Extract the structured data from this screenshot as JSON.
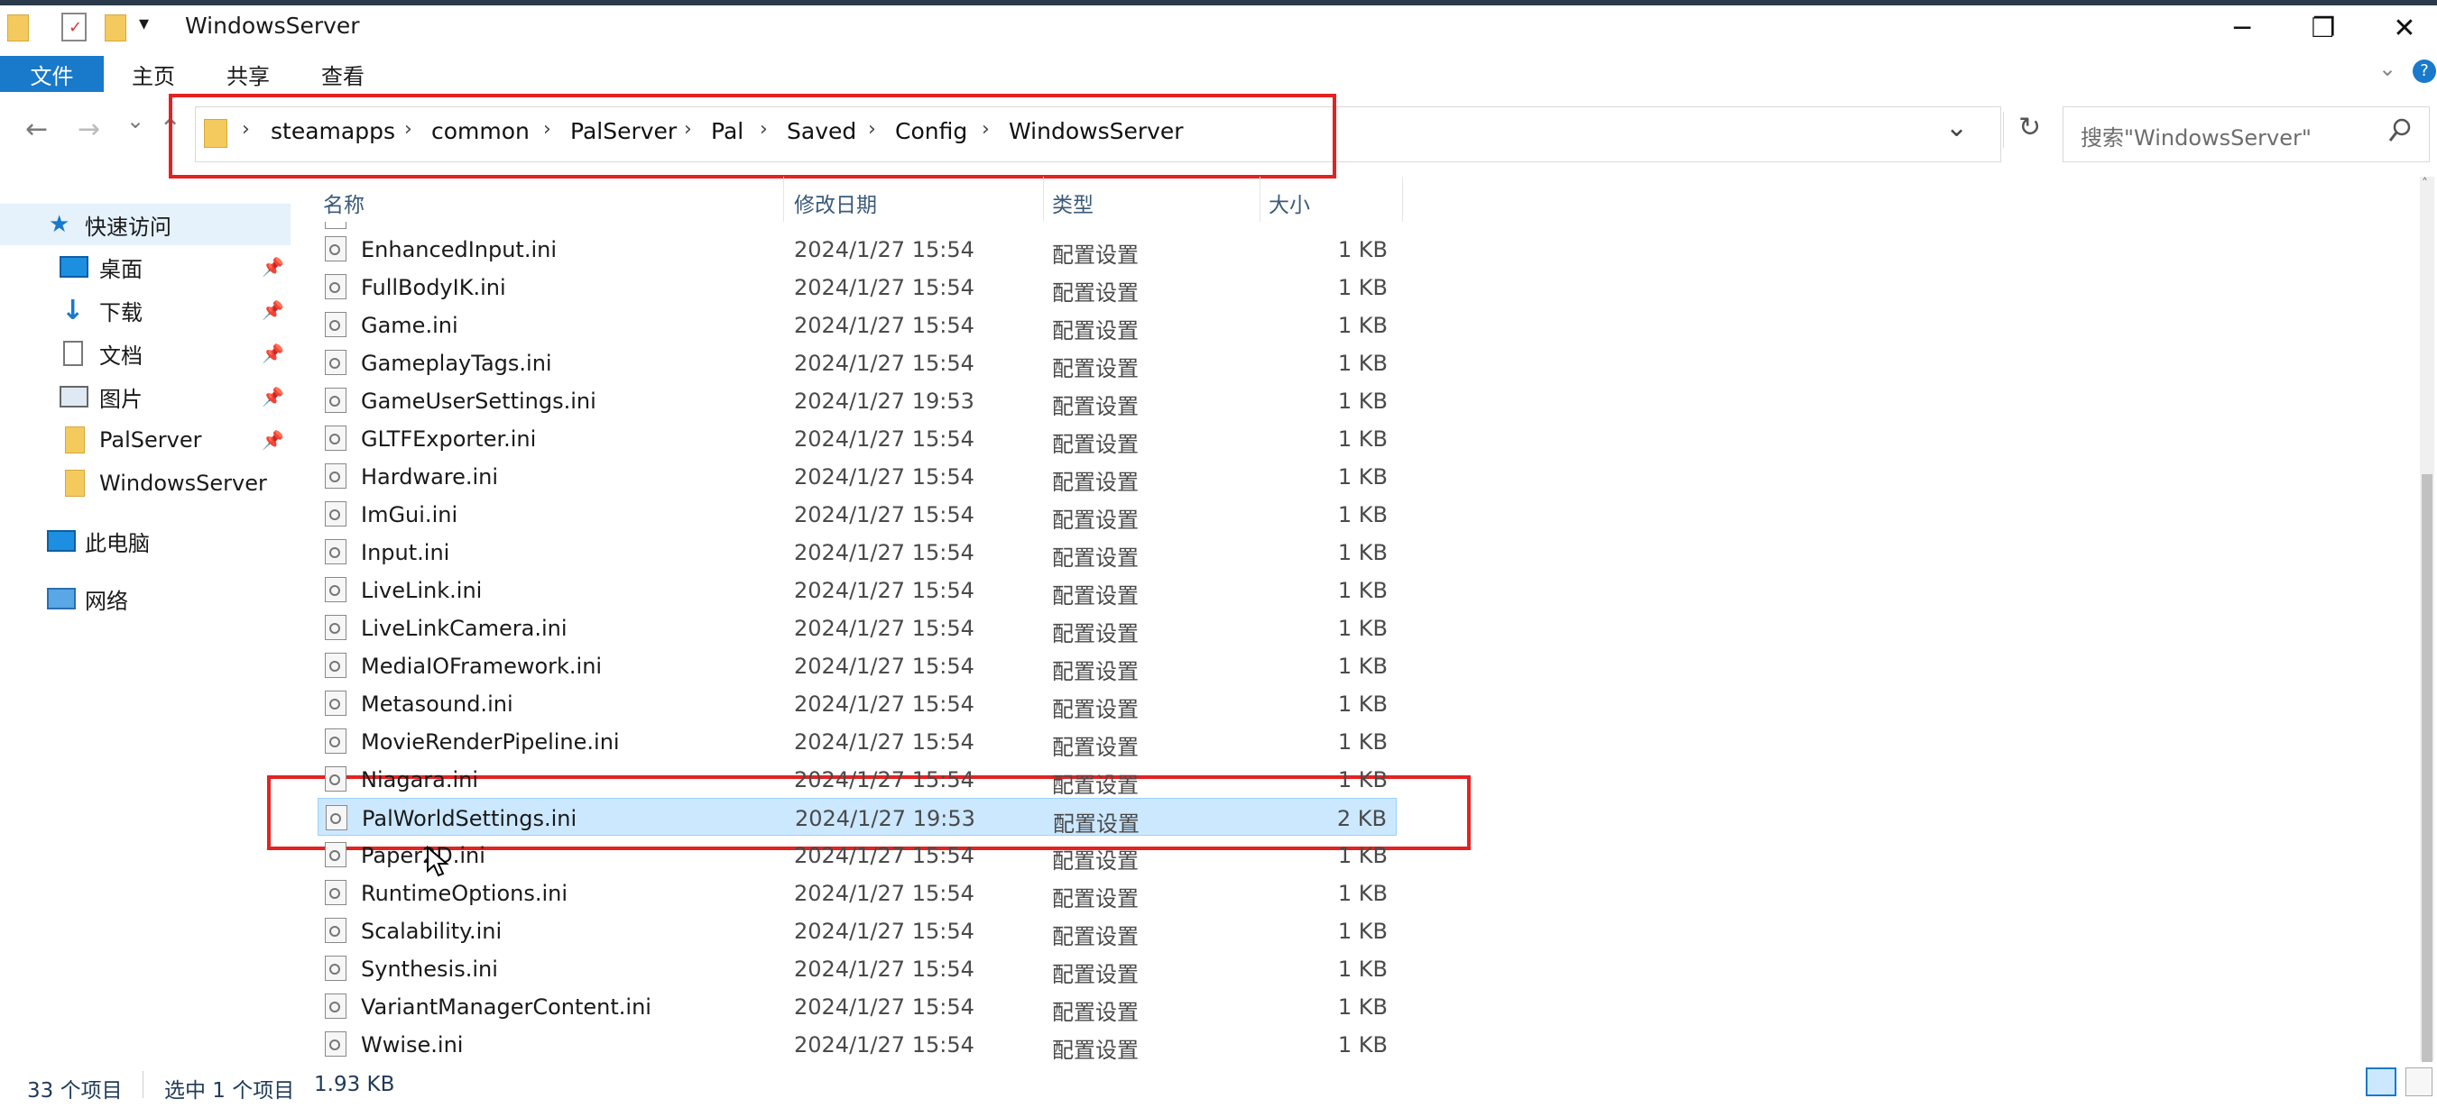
{
  "window": {
    "title": "WindowsServer",
    "controls": {
      "minimize": "─",
      "maximize": "❐",
      "close": "✕"
    }
  },
  "ribbon": {
    "tabs": [
      "文件",
      "主页",
      "共享",
      "查看"
    ]
  },
  "nav": {
    "back": "←",
    "forward": "→",
    "recent": "⌄",
    "up": "↑",
    "refresh": "↻",
    "dropdown": "⌄"
  },
  "breadcrumb": [
    "steamapps",
    "common",
    "PalServer",
    "Pal",
    "Saved",
    "Config",
    "WindowsServer"
  ],
  "search": {
    "placeholder": "搜索\"WindowsServer\""
  },
  "sidebar": {
    "quick_access": "快速访问",
    "items": [
      {
        "label": "桌面",
        "icon": "desktop-icon",
        "pinned": true
      },
      {
        "label": "下载",
        "icon": "download-icon",
        "pinned": true
      },
      {
        "label": "文档",
        "icon": "document-icon",
        "pinned": true
      },
      {
        "label": "图片",
        "icon": "picture-icon",
        "pinned": true
      },
      {
        "label": "PalServer",
        "icon": "folder-icon",
        "pinned": true
      },
      {
        "label": "WindowsServer",
        "icon": "folder-icon",
        "pinned": false
      }
    ],
    "this_pc": "此电脑",
    "network": "网络"
  },
  "columns": {
    "name": "名称",
    "modified": "修改日期",
    "type": "类型",
    "size": "大小"
  },
  "files": [
    {
      "name": "EnhancedInput.ini",
      "modified": "2024/1/27 15:54",
      "type": "配置设置",
      "size": "1 KB"
    },
    {
      "name": "FullBodyIK.ini",
      "modified": "2024/1/27 15:54",
      "type": "配置设置",
      "size": "1 KB"
    },
    {
      "name": "Game.ini",
      "modified": "2024/1/27 15:54",
      "type": "配置设置",
      "size": "1 KB"
    },
    {
      "name": "GameplayTags.ini",
      "modified": "2024/1/27 15:54",
      "type": "配置设置",
      "size": "1 KB"
    },
    {
      "name": "GameUserSettings.ini",
      "modified": "2024/1/27 19:53",
      "type": "配置设置",
      "size": "1 KB"
    },
    {
      "name": "GLTFExporter.ini",
      "modified": "2024/1/27 15:54",
      "type": "配置设置",
      "size": "1 KB"
    },
    {
      "name": "Hardware.ini",
      "modified": "2024/1/27 15:54",
      "type": "配置设置",
      "size": "1 KB"
    },
    {
      "name": "ImGui.ini",
      "modified": "2024/1/27 15:54",
      "type": "配置设置",
      "size": "1 KB"
    },
    {
      "name": "Input.ini",
      "modified": "2024/1/27 15:54",
      "type": "配置设置",
      "size": "1 KB"
    },
    {
      "name": "LiveLink.ini",
      "modified": "2024/1/27 15:54",
      "type": "配置设置",
      "size": "1 KB"
    },
    {
      "name": "LiveLinkCamera.ini",
      "modified": "2024/1/27 15:54",
      "type": "配置设置",
      "size": "1 KB"
    },
    {
      "name": "MediaIOFramework.ini",
      "modified": "2024/1/27 15:54",
      "type": "配置设置",
      "size": "1 KB"
    },
    {
      "name": "Metasound.ini",
      "modified": "2024/1/27 15:54",
      "type": "配置设置",
      "size": "1 KB"
    },
    {
      "name": "MovieRenderPipeline.ini",
      "modified": "2024/1/27 15:54",
      "type": "配置设置",
      "size": "1 KB"
    },
    {
      "name": "Niagara.ini",
      "modified": "2024/1/27 15:54",
      "type": "配置设置",
      "size": "1 KB"
    },
    {
      "name": "PalWorldSettings.ini",
      "modified": "2024/1/27 19:53",
      "type": "配置设置",
      "size": "2 KB",
      "selected": true
    },
    {
      "name": "Paper2D.ini",
      "modified": "2024/1/27 15:54",
      "type": "配置设置",
      "size": "1 KB"
    },
    {
      "name": "RuntimeOptions.ini",
      "modified": "2024/1/27 15:54",
      "type": "配置设置",
      "size": "1 KB"
    },
    {
      "name": "Scalability.ini",
      "modified": "2024/1/27 15:54",
      "type": "配置设置",
      "size": "1 KB"
    },
    {
      "name": "Synthesis.ini",
      "modified": "2024/1/27 15:54",
      "type": "配置设置",
      "size": "1 KB"
    },
    {
      "name": "VariantManagerContent.ini",
      "modified": "2024/1/27 15:54",
      "type": "配置设置",
      "size": "1 KB"
    },
    {
      "name": "Wwise.ini",
      "modified": "2024/1/27 15:54",
      "type": "配置设置",
      "size": "1 KB"
    }
  ],
  "status": {
    "count": "33 个项目",
    "selected": "选中 1 个项目",
    "size": "1.93 KB"
  },
  "colors": {
    "accent": "#1979ca",
    "selection": "#cce8ff",
    "annotation": "#e32222"
  }
}
